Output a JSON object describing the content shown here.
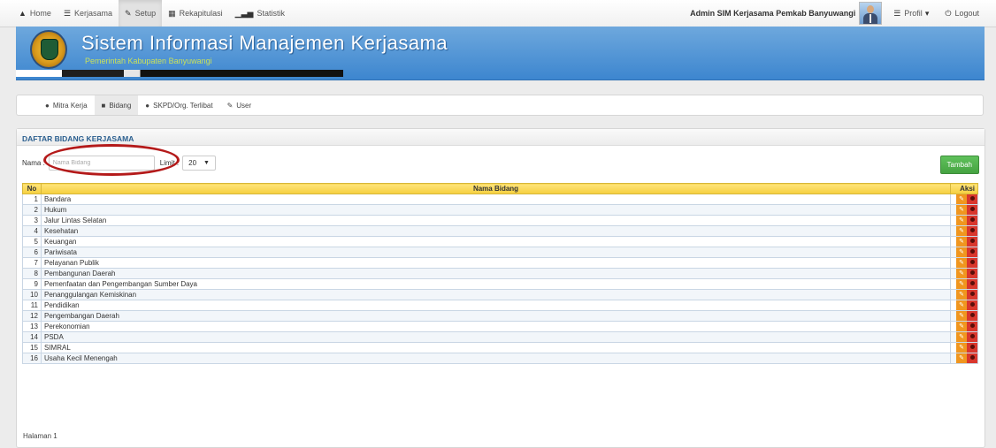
{
  "navbar": {
    "items": [
      {
        "icon": "home-icon",
        "label": "Home"
      },
      {
        "icon": "list-icon",
        "label": "Kerjasama"
      },
      {
        "icon": "wrench-icon",
        "label": "Setup"
      },
      {
        "icon": "table-icon",
        "label": "Rekapitulasi"
      },
      {
        "icon": "bar-chart-icon",
        "label": "Statistik"
      }
    ],
    "admin_name": "Admin SIM Kerjasama Pemkab Banyuwangi",
    "profil_label": "Profil",
    "logout_label": "Logout"
  },
  "banner": {
    "title": "Sistem Informasi Manajemen Kerjasama",
    "subtitle": "Pemerintah Kabupaten Banyuwangi"
  },
  "subnav": {
    "items": [
      {
        "icon": "user-icon",
        "label": "Mitra Kerja"
      },
      {
        "icon": "briefcase-icon",
        "label": "Bidang"
      },
      {
        "icon": "user-icon",
        "label": "SKPD/Org. Terlibat"
      },
      {
        "icon": "edit-icon",
        "label": "User"
      }
    ]
  },
  "panel": {
    "title": "DAFTAR BIDANG KERJASAMA",
    "nama_label": "Nama :",
    "nama_placeholder": "Nama Bidang",
    "limit_label": "Limit :",
    "limit_value": "20",
    "tambah_label": "Tambah"
  },
  "table": {
    "headers": {
      "no": "No",
      "nama": "Nama Bidang",
      "aksi": "Aksi"
    },
    "rows": [
      {
        "no": "1",
        "nama": "Bandara"
      },
      {
        "no": "2",
        "nama": "Hukum"
      },
      {
        "no": "3",
        "nama": "Jalur Lintas Selatan"
      },
      {
        "no": "4",
        "nama": "Kesehatan"
      },
      {
        "no": "5",
        "nama": "Keuangan"
      },
      {
        "no": "6",
        "nama": "Pariwisata"
      },
      {
        "no": "7",
        "nama": "Pelayanan Publik"
      },
      {
        "no": "8",
        "nama": "Pembangunan Daerah"
      },
      {
        "no": "9",
        "nama": "Pemenfaatan dan Pengembangan Sumber Daya"
      },
      {
        "no": "10",
        "nama": "Penanggulangan Kemiskinan"
      },
      {
        "no": "11",
        "nama": "Pendidikan"
      },
      {
        "no": "12",
        "nama": "Pengembangan Daerah"
      },
      {
        "no": "13",
        "nama": "Perekonomian"
      },
      {
        "no": "14",
        "nama": "PSDA"
      },
      {
        "no": "15",
        "nama": "SIMRAL"
      },
      {
        "no": "16",
        "nama": "Usaha Kecil Menengah"
      }
    ]
  },
  "footer": {
    "page_text": "Halaman 1"
  },
  "colors": {
    "banner": "#4a90d9",
    "table_header": "#f5cf3e",
    "tambah": "#4cae4c",
    "edit": "#f0961f",
    "delete": "#d9372d",
    "highlight_ellipse": "#b41a1a"
  }
}
